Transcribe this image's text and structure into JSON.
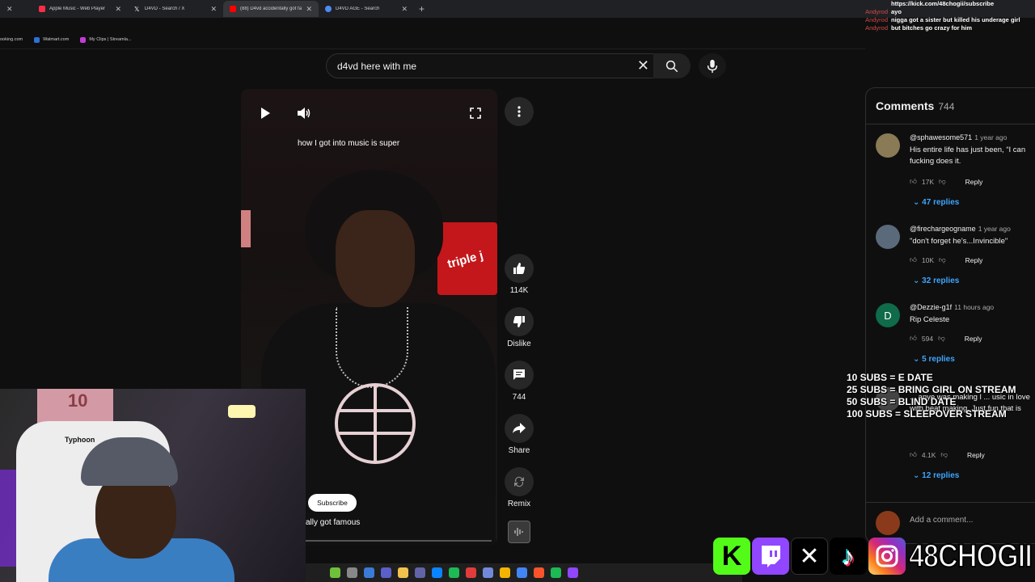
{
  "browser": {
    "tabs": [
      {
        "title": "Apple Music - Web Player",
        "color": "#fa2d48"
      },
      {
        "title": "D4VD - Search / X",
        "color": "#000000"
      },
      {
        "title": "(88) D4vd accidentally got famo",
        "color": "#ff0000"
      },
      {
        "title": "D4VD AGE - Search",
        "color": "#4c8bf5"
      }
    ],
    "bookmarks": [
      {
        "label": "ooking.com"
      },
      {
        "label": "Walmart.com"
      },
      {
        "label": "My Clips | Streamla..."
      }
    ]
  },
  "search": {
    "query": "d4vd here with me"
  },
  "chat": {
    "url": "https://kick.com/48chogii/subscribe",
    "messages": [
      {
        "user": "Andyrod",
        "text": "ayo"
      },
      {
        "user": "Andyrod",
        "text": "nigga got a sister but killed his underage girl"
      },
      {
        "user": "Andyrod",
        "text": "but bitches go crazy for him"
      }
    ]
  },
  "video": {
    "caption": "how I got into music is super",
    "subscribe_label": "Subscribe",
    "title_partial": "ally got famous",
    "sign_text": "triple j"
  },
  "actions": {
    "likes": "114K",
    "dislike_label": "Dislike",
    "comments_count": "744",
    "share_label": "Share",
    "remix_label": "Remix"
  },
  "comments": {
    "title": "Comments",
    "count": "744",
    "reply_label": "Reply",
    "add_placeholder": "Add a comment...",
    "items": [
      {
        "author": "@sphawesome571",
        "time": "1 year ago",
        "text": "His entire life has just been, “I can fucking does it.",
        "likes": "17K",
        "replies": "47 replies",
        "avatar_color": "#8a7a55",
        "initial": ""
      },
      {
        "author": "@firechargeogname",
        "time": "1 year ago",
        "text": "\"don't forget he's...Invincible\"",
        "likes": "10K",
        "replies": "32 replies",
        "avatar_color": "#5a6a7a",
        "initial": ""
      },
      {
        "author": "@Dezzie-g1f",
        "time": "11 hours ago",
        "text": "Rip Celeste",
        "likes": "594",
        "replies": "5 replies",
        "avatar_color": "#0f6b4a",
        "initial": "D"
      },
      {
        "author": "",
        "time": "",
        "text": "... anye was making l ... usic in love with beat making. Just fun that is",
        "likes": "4.1K",
        "replies": "12 replies",
        "avatar_color": "#444444",
        "initial": ""
      }
    ]
  },
  "goals": [
    "10 SUBS = E DATE",
    "25 SUBS = BRING GIRL ON STREAM",
    "50 SUBS = BLIND DATE",
    "100 SUBS = SLEEPOVER STREAM"
  ],
  "webcam": {
    "chair_brand": "Typhoon",
    "poster_number": "10"
  },
  "socials": {
    "handle": "48CHOGII",
    "platforms": [
      "kick-icon",
      "twitch-icon",
      "x-icon",
      "tiktok-icon",
      "instagram-icon"
    ]
  }
}
